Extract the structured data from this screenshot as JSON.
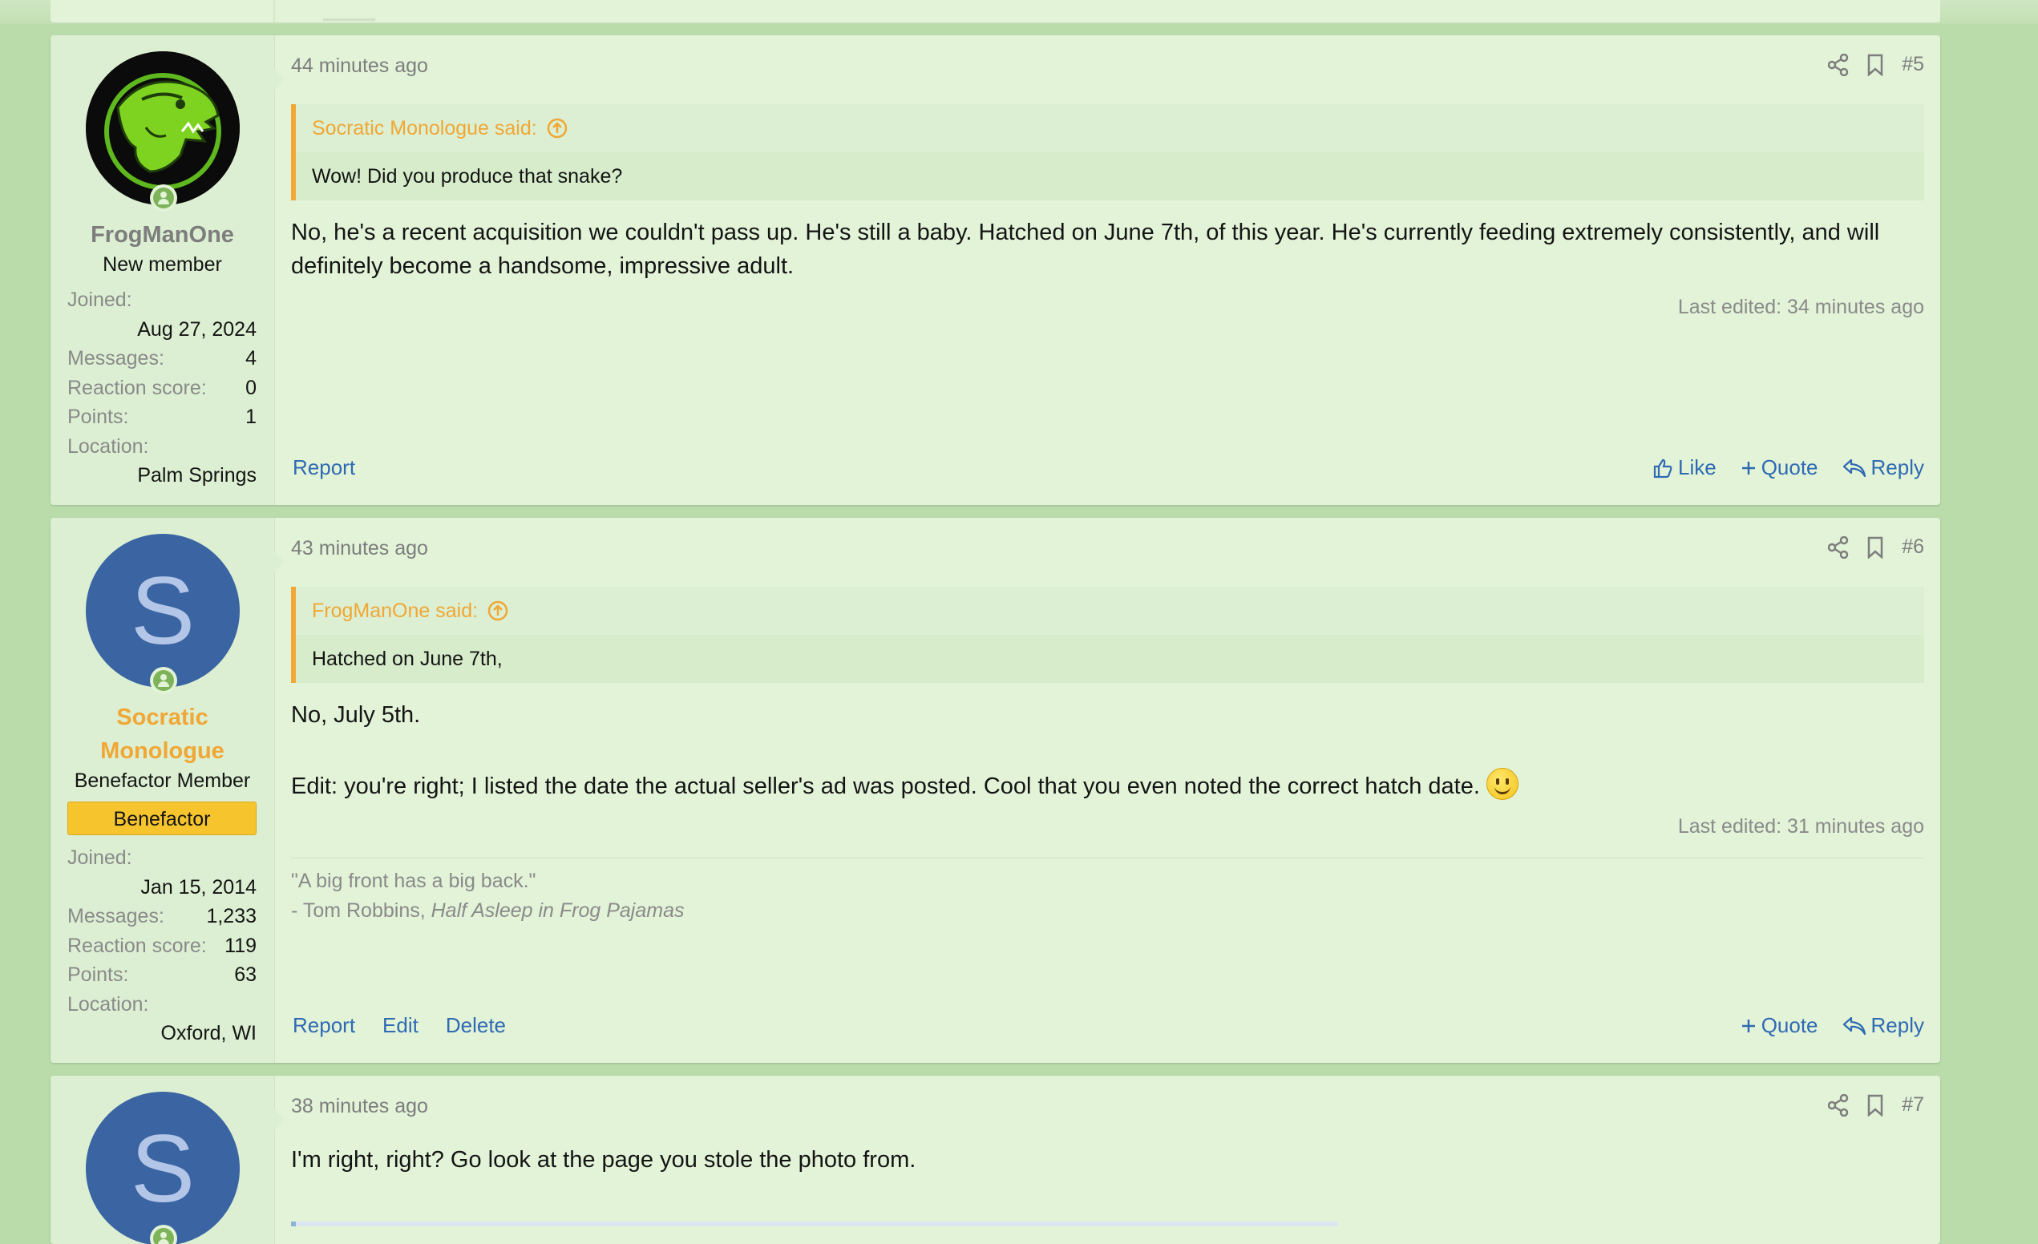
{
  "posts": [
    {
      "time": "44 minutes ago",
      "number": "#5",
      "user": {
        "name": "FrogManOne",
        "title": "New member",
        "joined_label": "Joined:",
        "joined": "Aug 27, 2024",
        "messages_label": "Messages:",
        "messages": "4",
        "reaction_label": "Reaction score:",
        "reaction": "0",
        "points_label": "Points:",
        "points": "1",
        "location_label": "Location:",
        "location": "Palm Springs"
      },
      "quote": {
        "author": "Socratic Monologue said:",
        "text": "Wow! Did you produce that snake?"
      },
      "body": "No, he's a recent acquisition we couldn't pass up. He's still a baby. Hatched on June 7th, of this year. He's currently feeding extremely consistently, and will definitely become a handsome, impressive adult.",
      "edited": "Last edited: 34 minutes ago",
      "footer": {
        "report": "Report",
        "like": "Like",
        "quote": "Quote",
        "reply": "Reply"
      }
    },
    {
      "time": "43 minutes ago",
      "number": "#6",
      "user": {
        "avatar_letter": "S",
        "name_line1": "Socratic",
        "name_line2": "Monologue",
        "title": "Benefactor Member",
        "banner": "Benefactor",
        "joined_label": "Joined:",
        "joined": "Jan 15, 2014",
        "messages_label": "Messages:",
        "messages": "1,233",
        "reaction_label": "Reaction score:",
        "reaction": "119",
        "points_label": "Points:",
        "points": "63",
        "location_label": "Location:",
        "location": "Oxford, WI"
      },
      "quote": {
        "author": "FrogManOne said:",
        "text": "Hatched on June 7th,"
      },
      "body1": "No, July 5th.",
      "body2": "Edit: you're right; I listed the date the actual seller's ad was posted. Cool that you even noted the correct hatch date.",
      "edited": "Last edited: 31 minutes ago",
      "signature": {
        "line1": "\"A big front has a big back.\"",
        "line2_prefix": "- Tom Robbins, ",
        "line2_title": "Half Asleep in Frog Pajamas"
      },
      "footer": {
        "report": "Report",
        "edit": "Edit",
        "delete": "Delete",
        "quote": "Quote",
        "reply": "Reply"
      }
    },
    {
      "time": "38 minutes ago",
      "number": "#7",
      "user": {
        "avatar_letter": "S"
      },
      "body": "I'm right, right? Go look at the page you stole the photo from."
    }
  ],
  "icons": {
    "share": "share-icon",
    "bookmark": "bookmark-icon",
    "jump": "jump-to-quote-icon",
    "like": "thumbs-up-icon",
    "plus": "plus-icon",
    "reply": "reply-arrow-icon",
    "online": "online-status-icon"
  },
  "colors": {
    "page_bg": "#b9dcaa",
    "post_bg": "#e2f3d8",
    "link": "#2f6ab3",
    "accent_orange": "#f0a735",
    "avatar_blue": "#3a64a2",
    "banner_yellow": "#f6c52e"
  }
}
